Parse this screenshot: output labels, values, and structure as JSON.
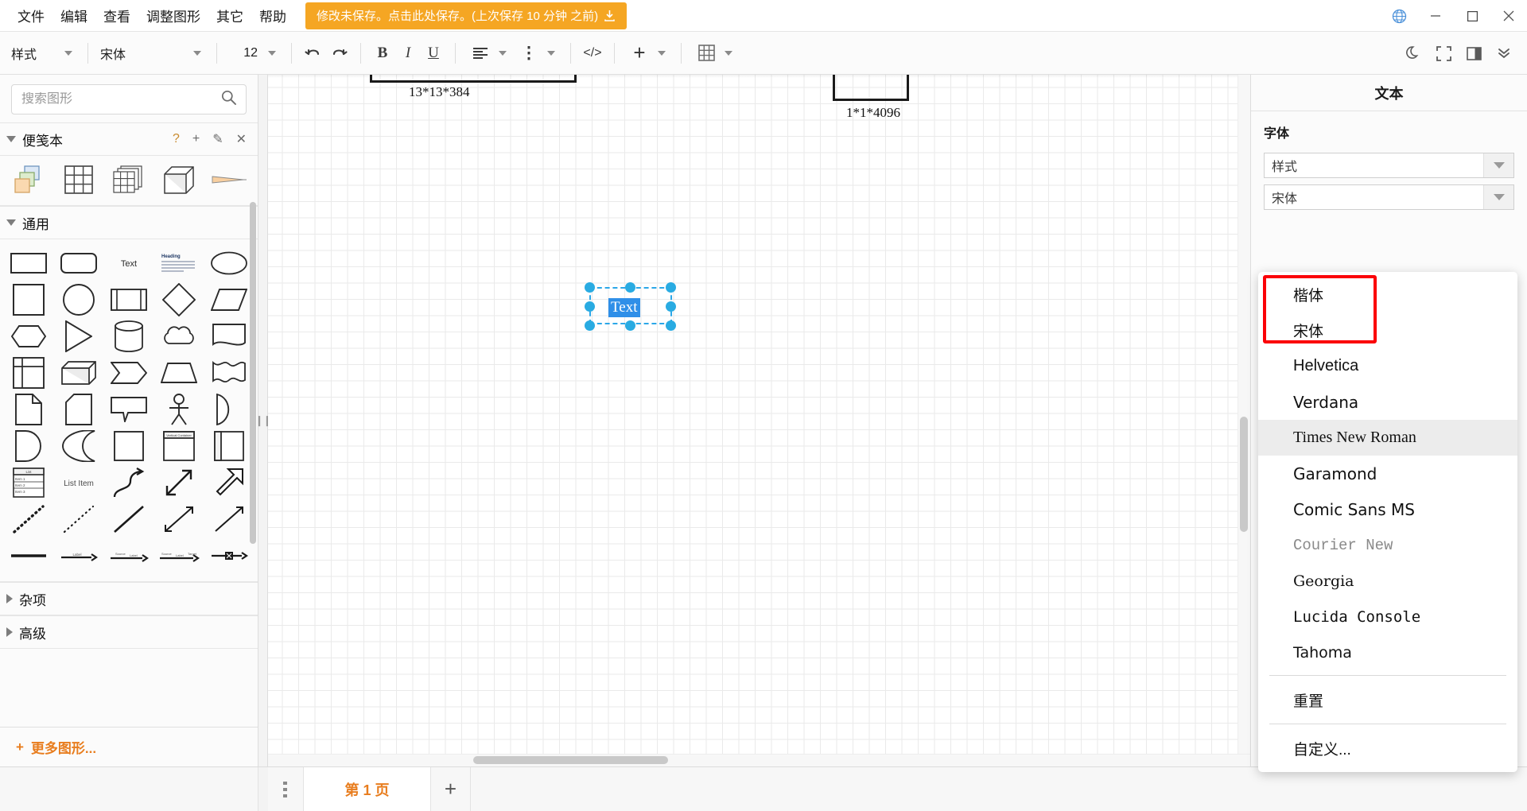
{
  "menubar": {
    "items": [
      {
        "label": "文件"
      },
      {
        "label": "编辑"
      },
      {
        "label": "查看"
      },
      {
        "label": "调整图形"
      },
      {
        "label": "其它"
      },
      {
        "label": "帮助"
      }
    ],
    "save_banner": {
      "text": "修改未保存。点击此处保存。(上次保存 10 分钟 之前)",
      "bg_color": "#f5a623",
      "icon": "download-icon"
    },
    "window_controls": [
      {
        "name": "language-globe-icon",
        "glyph": "🌐"
      },
      {
        "name": "minimize-icon",
        "glyph": "–"
      },
      {
        "name": "maximize-icon",
        "glyph": "□"
      },
      {
        "name": "close-icon",
        "glyph": "✕"
      }
    ]
  },
  "toolbar": {
    "style_label": "样式",
    "font_label": "宋体",
    "font_size": "12",
    "undo_icon": "undo-icon",
    "redo_icon": "redo-icon",
    "bold_label": "B",
    "italic_label": "I",
    "underline_label": "U",
    "align_icon": "align-left-icon",
    "vertical_align_icon": "vertical-align-icon",
    "code_label": "</>",
    "insert_label": "+",
    "table_icon": "table-icon",
    "right_icons": [
      {
        "name": "dark-mode-moon-icon"
      },
      {
        "name": "fullscreen-icon"
      },
      {
        "name": "toggle-format-panel-icon"
      },
      {
        "name": "collapse-toolbar-icon"
      }
    ]
  },
  "shapes_panel": {
    "search": {
      "placeholder": "搜索图形",
      "value": "",
      "icon": "search-icon"
    },
    "sections": [
      {
        "title": "便笺本",
        "expanded": true,
        "actions": [
          {
            "name": "help-icon",
            "glyph": "?"
          },
          {
            "name": "add-icon",
            "glyph": "+"
          },
          {
            "name": "edit-pencil-icon",
            "glyph": "✎"
          },
          {
            "name": "close-icon",
            "glyph": "✕"
          }
        ]
      },
      {
        "title": "通用",
        "expanded": true
      },
      {
        "title": "杂项",
        "expanded": false
      },
      {
        "title": "高级",
        "expanded": false
      }
    ],
    "more_shapes_label": "更多图形...",
    "more_shapes_color": "#e87d1e",
    "scratchpad_shapes": [
      "layers-shape",
      "grid-3x3-shape",
      "grid-stack-shape",
      "cube-shape",
      "cone-arrow-shape"
    ],
    "general_shapes_text": {
      "text_label": "Text",
      "heading_label": "Heading",
      "list_title": "List",
      "list_items": [
        "Item 1",
        "Item 2",
        "Item 3"
      ],
      "list_item_label": "List Item",
      "label_edge": "Label",
      "source_label": "Source",
      "target_label": "Target"
    }
  },
  "canvas": {
    "shape_labels": [
      {
        "text": "13*13*384"
      },
      {
        "text": "1*1*4096"
      }
    ],
    "selected_element": {
      "text": "Text",
      "selection_color": "#29abe2",
      "text_highlight_color": "#2f8fe8"
    }
  },
  "format_panel": {
    "title": "文本",
    "font_section_label": "字体",
    "style_select": {
      "value": "样式"
    },
    "font_select": {
      "value": "宋体"
    },
    "font_menu": {
      "highlight_color": "#fb0007",
      "selected_item": "Times New Roman",
      "items": [
        {
          "label": "楷体",
          "class": "f-kai",
          "highlighted": true
        },
        {
          "label": "宋体",
          "class": "f-song",
          "highlighted": true
        },
        {
          "label": "Helvetica",
          "class": "f-helv",
          "highlighted": false
        },
        {
          "label": "Verdana",
          "class": "f-verd",
          "highlighted": false
        },
        {
          "label": "Times New Roman",
          "class": "f-tnr",
          "highlighted": false
        },
        {
          "label": "Garamond",
          "class": "f-gara",
          "highlighted": false
        },
        {
          "label": "Comic Sans MS",
          "class": "f-comic",
          "highlighted": false
        },
        {
          "label": "Courier New",
          "class": "f-cour",
          "highlighted": false
        },
        {
          "label": "Georgia",
          "class": "f-geor",
          "highlighted": false
        },
        {
          "label": "Lucida Console",
          "class": "f-luc",
          "highlighted": false
        },
        {
          "label": "Tahoma",
          "class": "f-taho",
          "highlighted": false
        }
      ],
      "reset_label": "重置",
      "custom_label": "自定义..."
    }
  },
  "footer": {
    "page_menu_icon": "page-menu-kebab-icon",
    "page_tab_label": "第 1 页",
    "add_page_label": "+",
    "active_tab_color": "#e87d1e"
  }
}
